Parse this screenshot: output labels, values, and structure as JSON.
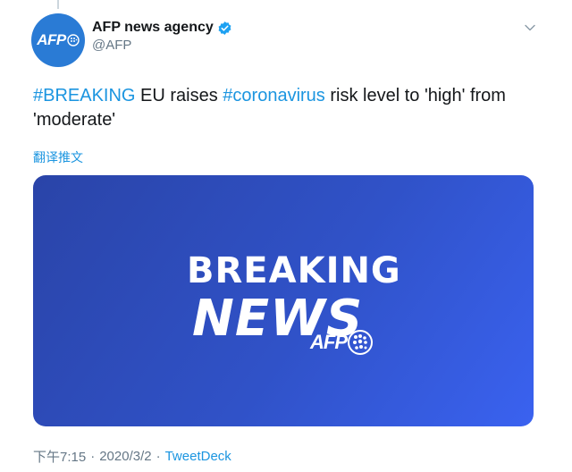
{
  "tweet": {
    "display_name": "AFP news agency",
    "handle": "@AFP",
    "avatar_text": "AFP",
    "text_parts": {
      "tag1": "#BREAKING",
      "plain1": " EU raises ",
      "tag2": "#coronavirus",
      "plain2": " risk level to 'high' from 'moderate'"
    },
    "translate_label": "翻译推文",
    "media": {
      "line1": "BREAKING",
      "line2": "NEWS",
      "brand": "AFP"
    },
    "time": "下午7:15",
    "separator": "·",
    "date": "2020/3/2",
    "source": "TweetDeck"
  },
  "colors": {
    "link": "#1b95e0",
    "muted": "#657786",
    "media_bg_start": "#2a44a8",
    "media_bg_end": "#3a62f0"
  },
  "icons": [
    "verified-badge-icon",
    "chevron-down-icon",
    "globe-icon"
  ]
}
